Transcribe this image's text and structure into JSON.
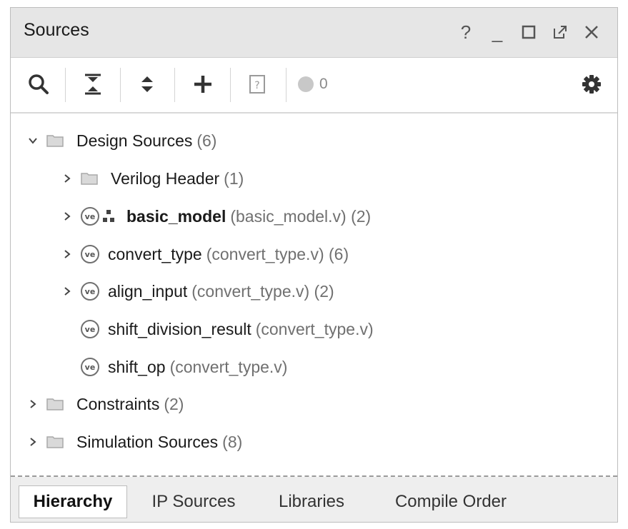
{
  "panel": {
    "title": "Sources",
    "window_controls": {
      "help": "?",
      "minimize": "_",
      "maximize": "□",
      "float": "⧉",
      "close": "×"
    }
  },
  "toolbar": {
    "icons": [
      "search-icon",
      "collapse-all-icon",
      "expand-all-icon",
      "add-icon",
      "unknown-file-icon",
      "status-dot-icon",
      "gear-icon"
    ],
    "message_count": "0"
  },
  "tree": {
    "design_sources": {
      "label": "Design Sources",
      "meta": "(6)"
    },
    "verilog_header": {
      "label": "Verilog Header",
      "meta": "(1)"
    },
    "basic_model": {
      "label": "basic_model",
      "meta": "(basic_model.v) (2)"
    },
    "convert_type": {
      "label": "convert_type",
      "meta": "(convert_type.v) (6)"
    },
    "align_input": {
      "label": "align_input",
      "meta": "(convert_type.v) (2)"
    },
    "shift_division_result": {
      "label": "shift_division_result",
      "meta": "(convert_type.v)"
    },
    "shift_op": {
      "label": "shift_op",
      "meta": "(convert_type.v)"
    },
    "constraints": {
      "label": "Constraints",
      "meta": "(2)"
    },
    "simulation_sources": {
      "label": "Simulation Sources",
      "meta": "(8)"
    }
  },
  "tabs": {
    "hierarchy": "Hierarchy",
    "ip_sources": "IP Sources",
    "libraries": "Libraries",
    "compile_order": "Compile Order"
  },
  "icon_text": {
    "ve": "ve"
  },
  "colors": {
    "title_bar": "#e6e6e6",
    "status_dot": "#c8c8c8",
    "tab_bar": "#eeeeee"
  }
}
